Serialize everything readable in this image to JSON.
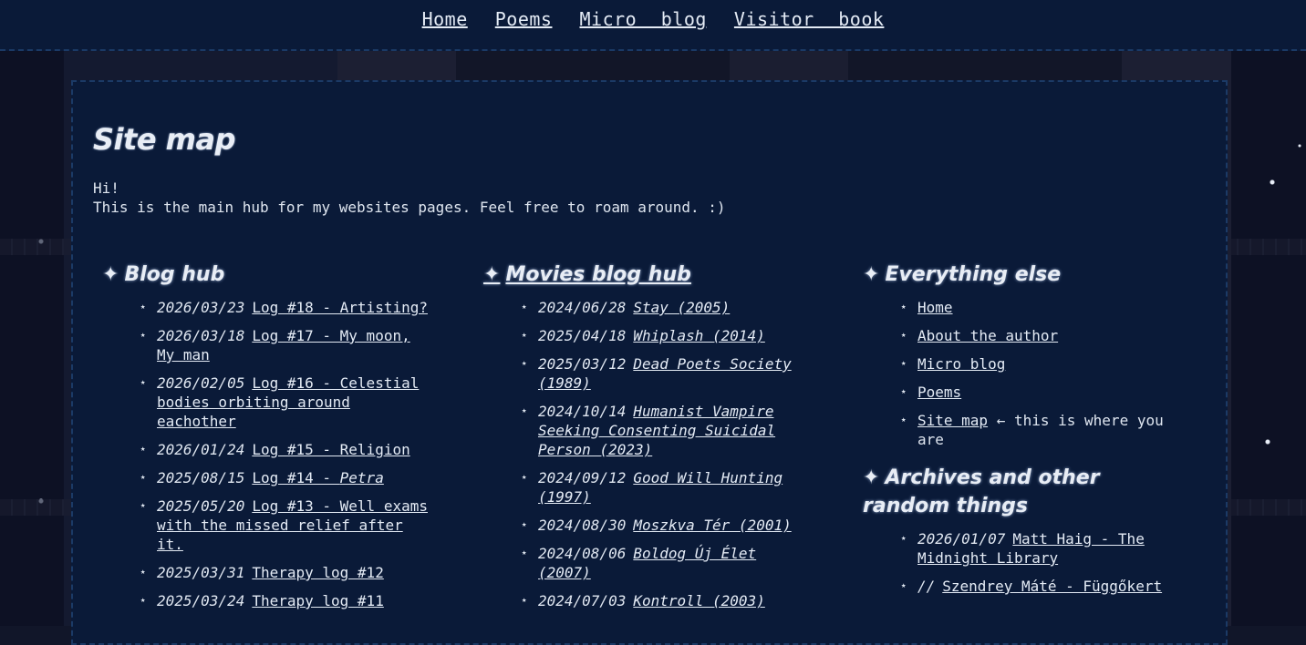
{
  "nav": {
    "items": [
      "Home",
      "Poems",
      "Micro blog",
      "Visitor book"
    ]
  },
  "page": {
    "title": "Site map",
    "intro_line1": "Hi!",
    "intro_line2": "This is the main hub for my websites pages. Feel free to roam around. :)"
  },
  "blog_hub": {
    "heading_star": "✦",
    "heading": "Blog hub",
    "items": [
      {
        "date": "2026/03/23",
        "title": "Log #18 - Artisting?"
      },
      {
        "date": "2026/03/18",
        "title": "Log #17 - My moon, My man"
      },
      {
        "date": "2026/02/05",
        "title": "Log #16 - Celestial bodies orbiting around eachother"
      },
      {
        "date": "2026/01/24",
        "title": "Log #15 - Religion"
      },
      {
        "date": "2025/08/15",
        "title_prefix": "Log #14 - ",
        "title_em": "Petra"
      },
      {
        "date": "2025/05/20",
        "title": "Log #13 - Well exams with the missed relief after it."
      },
      {
        "date": "2025/03/31",
        "title": "Therapy log #12"
      },
      {
        "date": "2025/03/24",
        "title": "Therapy log #11"
      }
    ]
  },
  "movies_hub": {
    "heading_star": "✦",
    "heading": "Movies blog hub",
    "items": [
      {
        "date": "2024/06/28",
        "title": "Stay (2005)"
      },
      {
        "date": "2025/04/18",
        "title": "Whiplash (2014)"
      },
      {
        "date": "2025/03/12",
        "title": "Dead Poets Society (1989)"
      },
      {
        "date": "2024/10/14",
        "title": "Humanist Vampire Seeking Consenting Suicidal Person (2023)"
      },
      {
        "date": "2024/09/12",
        "title": "Good Will Hunting (1997)"
      },
      {
        "date": "2024/08/30",
        "title": "Moszkva Tér (2001)"
      },
      {
        "date": "2024/08/06",
        "title": "Boldog Új Élet (2007)"
      },
      {
        "date": "2024/07/03",
        "title": "Kontroll (2003)"
      }
    ]
  },
  "everything_else": {
    "heading_star": "✦",
    "heading": "Everything else",
    "items": [
      {
        "title": "Home"
      },
      {
        "title": "About the author"
      },
      {
        "title": "Micro blog"
      },
      {
        "title": "Poems"
      },
      {
        "title": "Site map",
        "note": "← this is where you are"
      }
    ]
  },
  "archives": {
    "heading_star": "✦",
    "heading": "Archives and other random things",
    "items": [
      {
        "date": "2026/01/07",
        "title": "Matt Haig - The Midnight Library"
      },
      {
        "date": "//",
        "title": "Szendrey Máté - Függőkert"
      }
    ]
  }
}
